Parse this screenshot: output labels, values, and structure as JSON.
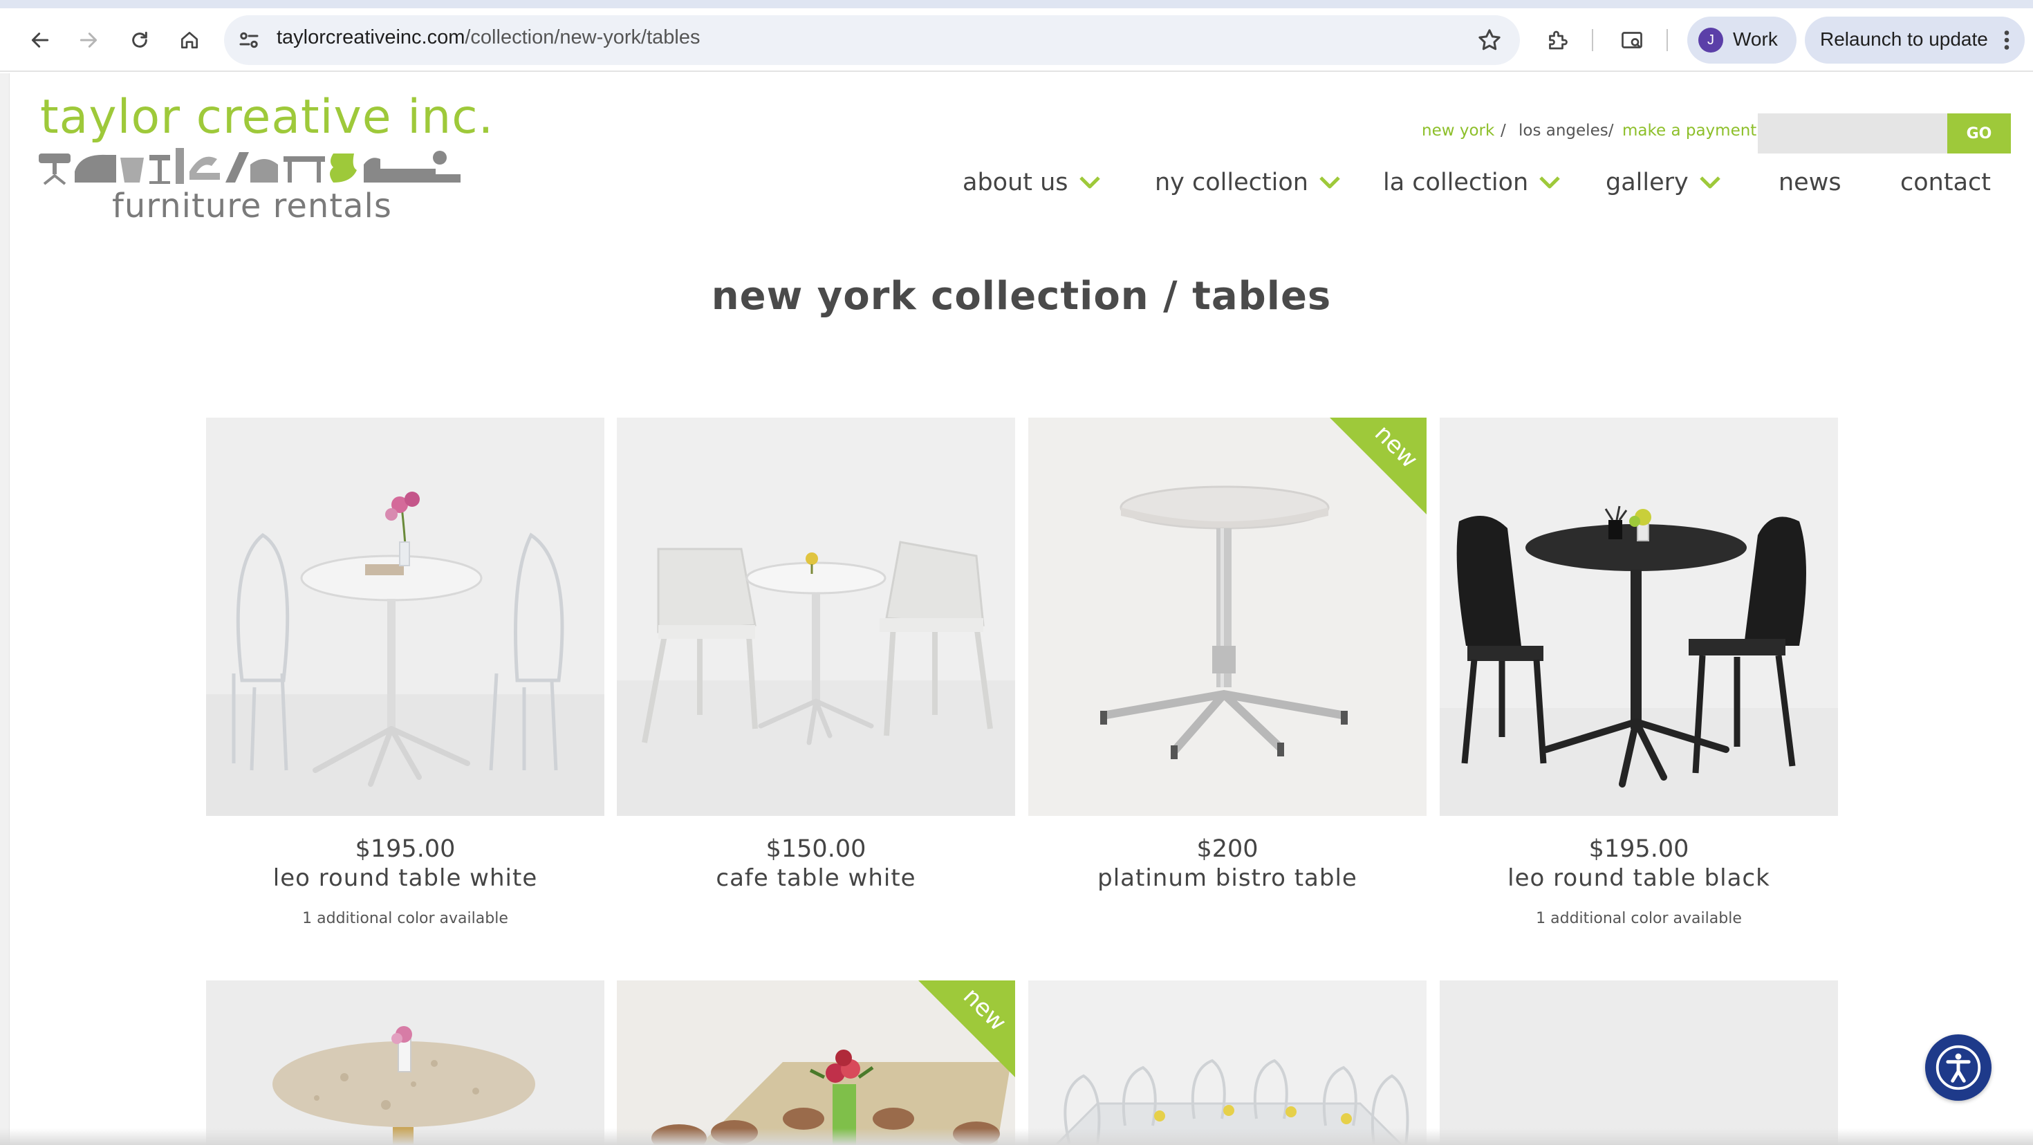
{
  "browser": {
    "url_domain": "taylorcreativeinc.com",
    "url_path": "/collection/new-york/tables",
    "profile_initial": "J",
    "profile_label": "Work",
    "relaunch_label": "Relaunch to update"
  },
  "site": {
    "logo_line1": "taylor creative inc.",
    "logo_line2": "furniture rentals",
    "location_ny": "new york",
    "location_sep": "/",
    "location_la": "los angeles/",
    "make_payment": "make a payment",
    "search_placeholder": "",
    "go_label": "GO",
    "nav": {
      "about": "about us",
      "ny": "ny collection",
      "la": "la collection",
      "gallery": "gallery",
      "news": "news",
      "contact": "contact"
    },
    "accent_color": "#9ec93a",
    "page_title": "new york collection / tables"
  },
  "products": [
    {
      "price": "$195.00",
      "name": "leo round table white",
      "extra": "1 additional color available",
      "new": false
    },
    {
      "price": "$150.00",
      "name": "cafe table white",
      "extra": "",
      "new": false
    },
    {
      "price": "$200",
      "name": "platinum bistro table",
      "extra": "",
      "new": true
    },
    {
      "price": "$195.00",
      "name": "leo round table black",
      "extra": "1 additional color available",
      "new": false
    },
    {
      "new": false
    },
    {
      "new": true
    },
    {
      "new": false
    },
    {
      "new": false
    }
  ],
  "badge_new_label": "new",
  "icons": [
    "back-icon",
    "forward-icon",
    "reload-icon",
    "home-icon",
    "site-info-icon",
    "bookmark-star-icon",
    "extensions-icon",
    "tab-search-icon",
    "more-vert-icon",
    "chevron-down-icon",
    "accessibility-icon"
  ]
}
